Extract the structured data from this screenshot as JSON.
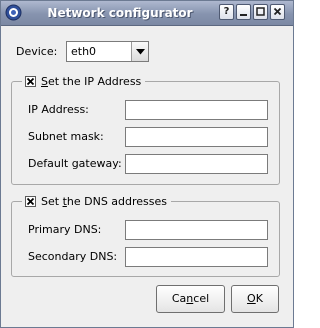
{
  "window": {
    "title": "Network configurator",
    "help_button": "?"
  },
  "device": {
    "label": "Device:",
    "selected": "eth0"
  },
  "ip_group": {
    "checked": true,
    "legend_pre": "",
    "legend_mnemonic": "S",
    "legend_post": "et the IP Address",
    "fields": [
      {
        "label": "IP Address:",
        "value": ""
      },
      {
        "label": "Subnet mask:",
        "value": ""
      },
      {
        "label": "Default gateway:",
        "value": ""
      }
    ]
  },
  "dns_group": {
    "checked": true,
    "legend_pre": "Set ",
    "legend_mnemonic": "t",
    "legend_post": "he DNS addresses",
    "fields": [
      {
        "label": "Primary DNS:",
        "value": ""
      },
      {
        "label": "Secondary DNS:",
        "value": ""
      }
    ]
  },
  "buttons": {
    "cancel_pre": "Ca",
    "cancel_mnemonic": "n",
    "cancel_post": "cel",
    "ok_pre": "",
    "ok_mnemonic": "O",
    "ok_post": "K"
  },
  "colors": {
    "titlebar": "#8693ae",
    "window_bg": "#efefef",
    "group_border": "#a8a8a8"
  }
}
